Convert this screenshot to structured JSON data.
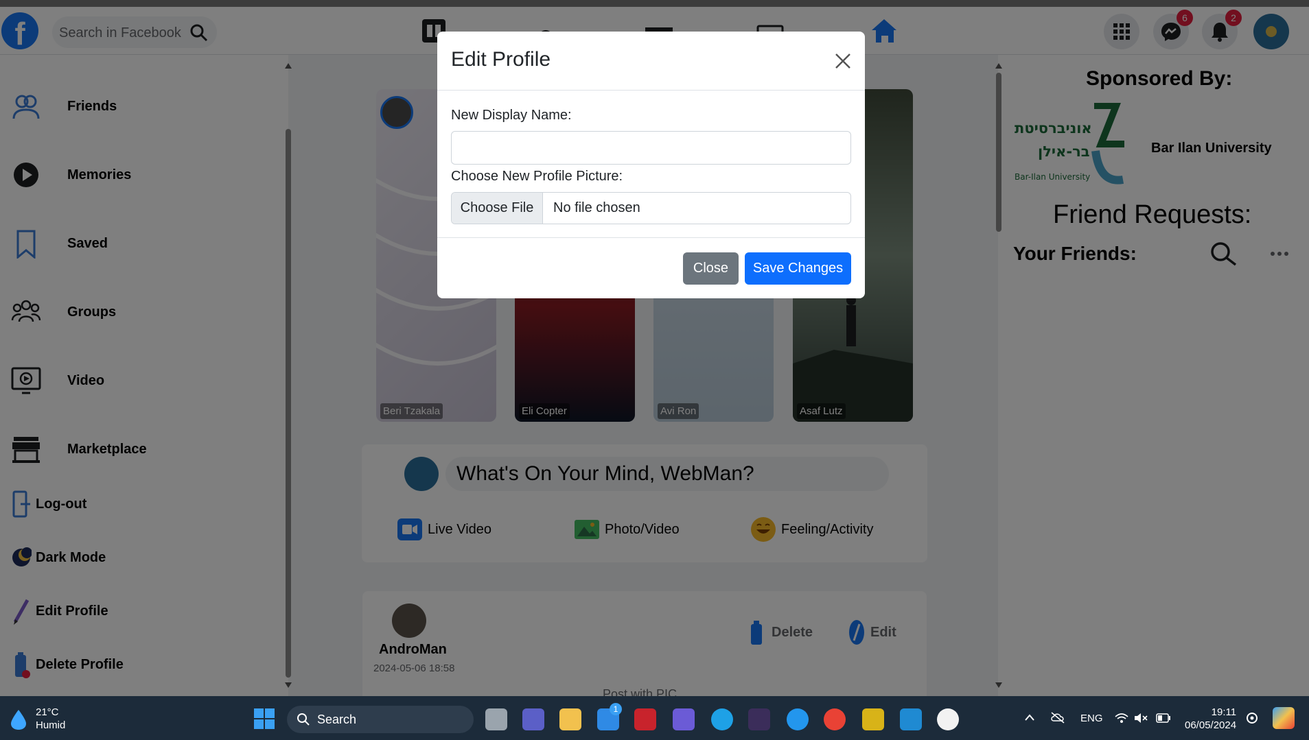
{
  "header": {
    "logo_text": "f",
    "search_placeholder": "Search in Facebook",
    "messenger_badge": "6",
    "notifications_badge": "2",
    "brand_color": "#1877f2"
  },
  "sidebar": {
    "items": [
      {
        "label": "Friends",
        "icon": "friends-icon"
      },
      {
        "label": "Memories",
        "icon": "memories-icon"
      },
      {
        "label": "Saved",
        "icon": "bookmark-icon"
      },
      {
        "label": "Groups",
        "icon": "groups-icon"
      },
      {
        "label": "Video",
        "icon": "video-icon"
      },
      {
        "label": "Marketplace",
        "icon": "store-icon"
      },
      {
        "label": "Log-out",
        "icon": "logout-icon"
      },
      {
        "label": "Dark Mode",
        "icon": "moon-icon"
      },
      {
        "label": "Edit Profile",
        "icon": "pencil-icon"
      },
      {
        "label": "Delete Profile",
        "icon": "trash-icon"
      }
    ]
  },
  "stories": [
    {
      "name": "Beri Tzakala"
    },
    {
      "name": "Eli Copter"
    },
    {
      "name": "Avi Ron"
    },
    {
      "name": "Asaf Lutz"
    }
  ],
  "composer": {
    "prompt": "What's On Your Mind, WebMan?",
    "actions": [
      {
        "label": "Live Video",
        "icon": "live-video-icon"
      },
      {
        "label": "Photo/Video",
        "icon": "photo-icon"
      },
      {
        "label": "Feeling/Activity",
        "icon": "smile-icon"
      }
    ]
  },
  "post": {
    "author": "AndroMan",
    "date": "2024-05-06 18:58",
    "delete_label": "Delete",
    "edit_label": "Edit",
    "text": "Post with PIC"
  },
  "rightbar": {
    "sponsored_title": "Sponsored By:",
    "sponsor_name": "Bar Ilan University",
    "sponsor_logo_hebrew_1": "אוניברסיטת",
    "sponsor_logo_hebrew_2": "בר-אילן",
    "sponsor_logo_en": "Bar-Ilan University",
    "friend_requests_title": "Friend Requests:",
    "your_friends_title": "Your Friends:"
  },
  "modal": {
    "title": "Edit Profile",
    "display_name_label": "New Display Name:",
    "display_name_value": "",
    "picture_label": "Choose New Profile Picture:",
    "choose_file_label": "Choose File",
    "no_file_text": "No file chosen",
    "close_label": "Close",
    "save_label": "Save Changes",
    "primary_color": "#0d6efd",
    "secondary_color": "#6c757d"
  },
  "taskbar": {
    "temperature": "21°C",
    "weather_text": "Humid",
    "search_label": "Search",
    "store_badge": "1",
    "language": "ENG",
    "time": "19:11",
    "date": "06/05/2024"
  }
}
